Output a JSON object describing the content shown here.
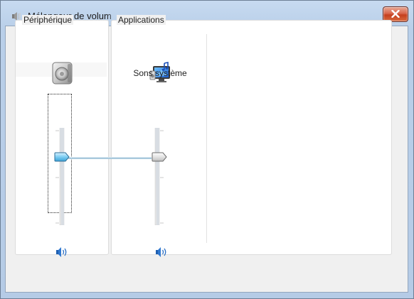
{
  "window": {
    "title": "Mélangeur de volum",
    "close_label": "Fermer"
  },
  "device": {
    "group_label": "Périphérique",
    "icon": "speaker-device-icon",
    "volume": 0.7,
    "mute_icon": "speaker-volume-icon"
  },
  "applications": {
    "group_label": "Applications",
    "channels": [
      {
        "label": "Sons système",
        "icon": "system-sounds-icon",
        "volume": 0.7,
        "mute_icon": "speaker-volume-icon"
      }
    ]
  },
  "colors": {
    "title_bar": "#b9cfe9",
    "close_button": "#c53f1f",
    "active_thumb": "#5fb8e6"
  }
}
